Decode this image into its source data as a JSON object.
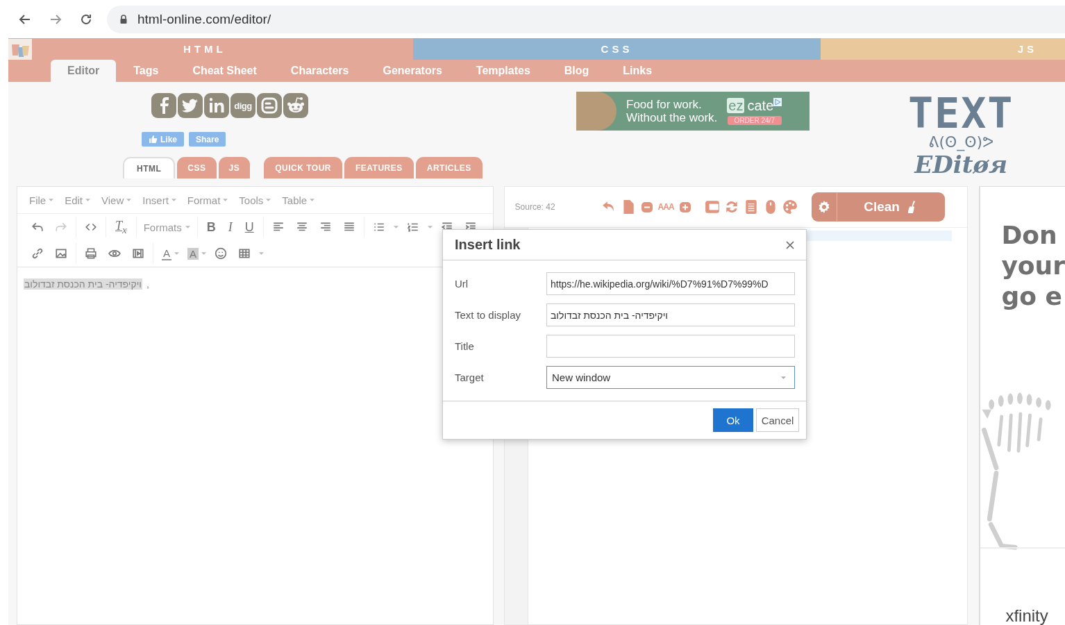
{
  "browser": {
    "address": "html-online.com/editor/"
  },
  "site_sections": [
    {
      "label": "HTML",
      "color": "#e3a898"
    },
    {
      "label": "CSS",
      "color": "#8fb5d3"
    },
    {
      "label": "JS",
      "color": "#e9c99b"
    }
  ],
  "nav_tabs": [
    {
      "label": "Editor",
      "selected": true
    },
    {
      "label": "Tags",
      "selected": false
    },
    {
      "label": "Cheat Sheet",
      "selected": false
    },
    {
      "label": "Characters",
      "selected": false
    },
    {
      "label": "Generators",
      "selected": false
    },
    {
      "label": "Templates",
      "selected": false
    },
    {
      "label": "Blog",
      "selected": false
    },
    {
      "label": "Links",
      "selected": false
    }
  ],
  "social": {
    "digg_label": "digg",
    "like_button": "Like",
    "share_button": "Share"
  },
  "editor_tabs": [
    {
      "label": "HTML",
      "kind": "mode",
      "selected": true
    },
    {
      "label": "CSS",
      "kind": "mode",
      "selected": false
    },
    {
      "label": "JS",
      "kind": "mode",
      "selected": false
    },
    {
      "label": "QUICK TOUR",
      "kind": "link",
      "selected": false
    },
    {
      "label": "FEATURES",
      "kind": "link",
      "selected": false
    },
    {
      "label": "ARTICLES",
      "kind": "link",
      "selected": false
    }
  ],
  "ad_banner": {
    "line_1": "Food for work.",
    "line_2": "Without the work.",
    "brand_prefix": "ez",
    "brand_suffix": "cate",
    "cta": "ORDER 24/7"
  },
  "logo": {
    "title": "TEXT",
    "face": "ᕕ(ʘ_ʘ)ᕗ",
    "subtitle": "EDitøя"
  },
  "wysiwyg": {
    "menu": [
      "File",
      "Edit",
      "View",
      "Insert",
      "Format",
      "Tools",
      "Table"
    ],
    "clear_format": "T$_{x}$",
    "formats": "Formats",
    "bold": "B",
    "italic": "I",
    "underline": "U",
    "text_color": "A",
    "background_color": "A",
    "content": {
      "link_text": "ויקיפדיה- בית הכנסת זבדולוב",
      "trailing": ","
    }
  },
  "source": {
    "label": "Source: 42",
    "font_sizes": "AAA",
    "clean_button": "Clean"
  },
  "right_ad": {
    "lines": [
      "Don",
      "your",
      "go e"
    ],
    "brand": "xfinity"
  },
  "dialog": {
    "title": "Insert link",
    "fields": [
      {
        "label": "Url",
        "kind": "text",
        "value": "https://he.wikipedia.org/wiki/%D7%91%D7%99%D",
        "focused": false
      },
      {
        "label": "Text to display",
        "kind": "text",
        "value": "ויקיפדיה- בית הכנסת זבדולוב",
        "focused": false
      },
      {
        "label": "Title",
        "kind": "text",
        "focused": false
      },
      {
        "label": "Target",
        "kind": "select",
        "value": "New window",
        "focused": true
      }
    ],
    "ok_button": "Ok",
    "cancel_button": "Cancel"
  }
}
